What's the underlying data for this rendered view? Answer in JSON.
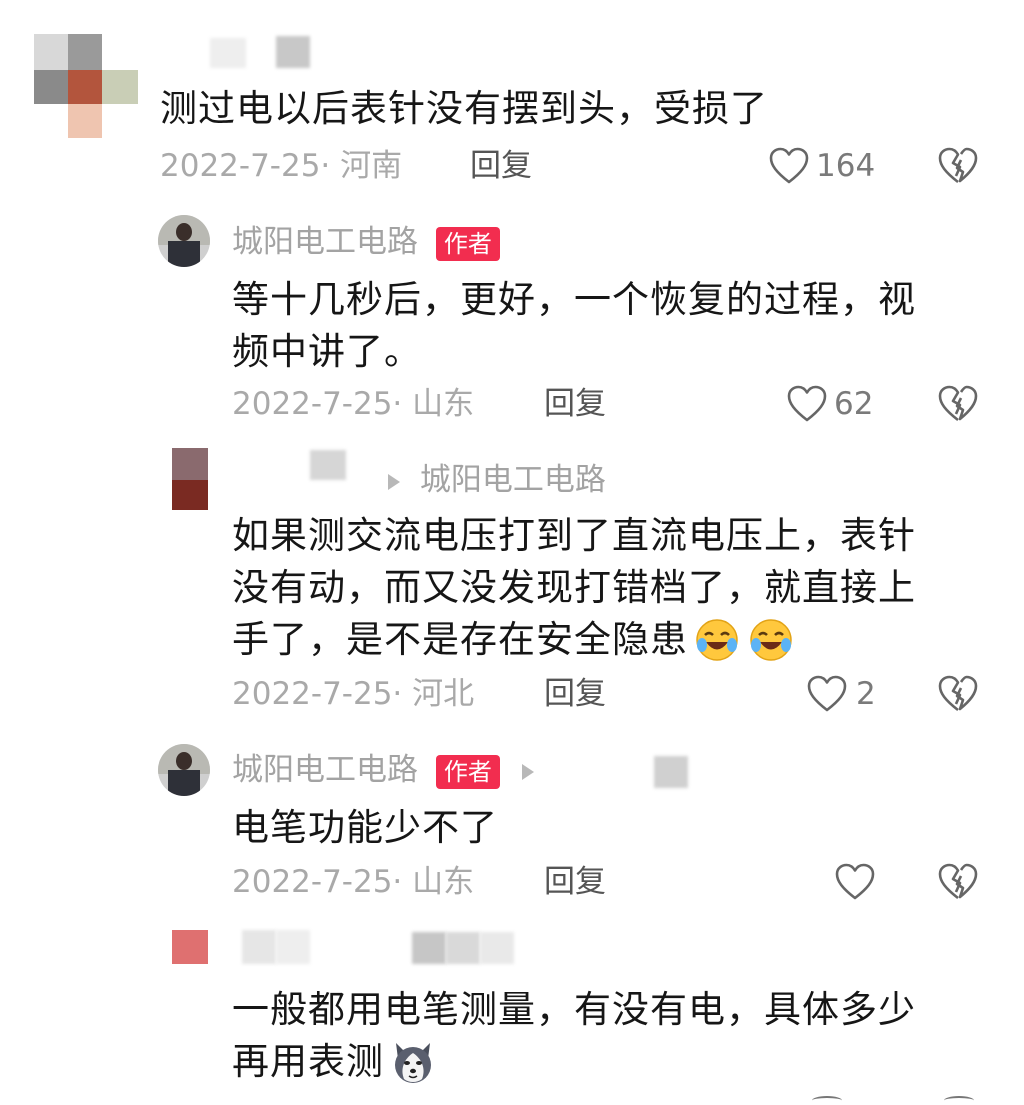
{
  "comments": [
    {
      "text": "测过电以后表针没有摆到头，受损了",
      "date_loc": "2022-7-25· 河南",
      "reply": "回复",
      "likes": "164"
    },
    {
      "author": "城阳电工电路",
      "badge": "作者",
      "text1": "等十几秒后，更好，一个恢复的过程，视",
      "text2": "频中讲了。",
      "date_loc": "2022-7-25· 山东",
      "reply": "回复",
      "likes": "62"
    },
    {
      "reply_to": "城阳电工电路",
      "text1": "如果测交流电压打到了直流电压上，表针",
      "text2": "没有动，而又没发现打错档了，就直接上",
      "text3": "手了，是不是存在安全隐患",
      "date_loc": "2022-7-25· 河北",
      "reply": "回复",
      "likes": "2"
    },
    {
      "author": "城阳电工电路",
      "badge": "作者",
      "text": "电笔功能少不了",
      "date_loc": "2022-7-25· 山东",
      "reply": "回复"
    },
    {
      "text1": "一般都用电笔测量，有没有电，具体多少",
      "text2": "再用表测"
    }
  ],
  "icons": {
    "like": "heart-outline-icon",
    "dislike": "broken-heart-icon",
    "arrow": "play-triangle-icon",
    "emoji_laugh": "laughing-crying-emoji",
    "emoji_dog": "husky-dog-emoji"
  },
  "colors": {
    "badge": "#f22d4f",
    "meta": "#a9a9a9"
  }
}
